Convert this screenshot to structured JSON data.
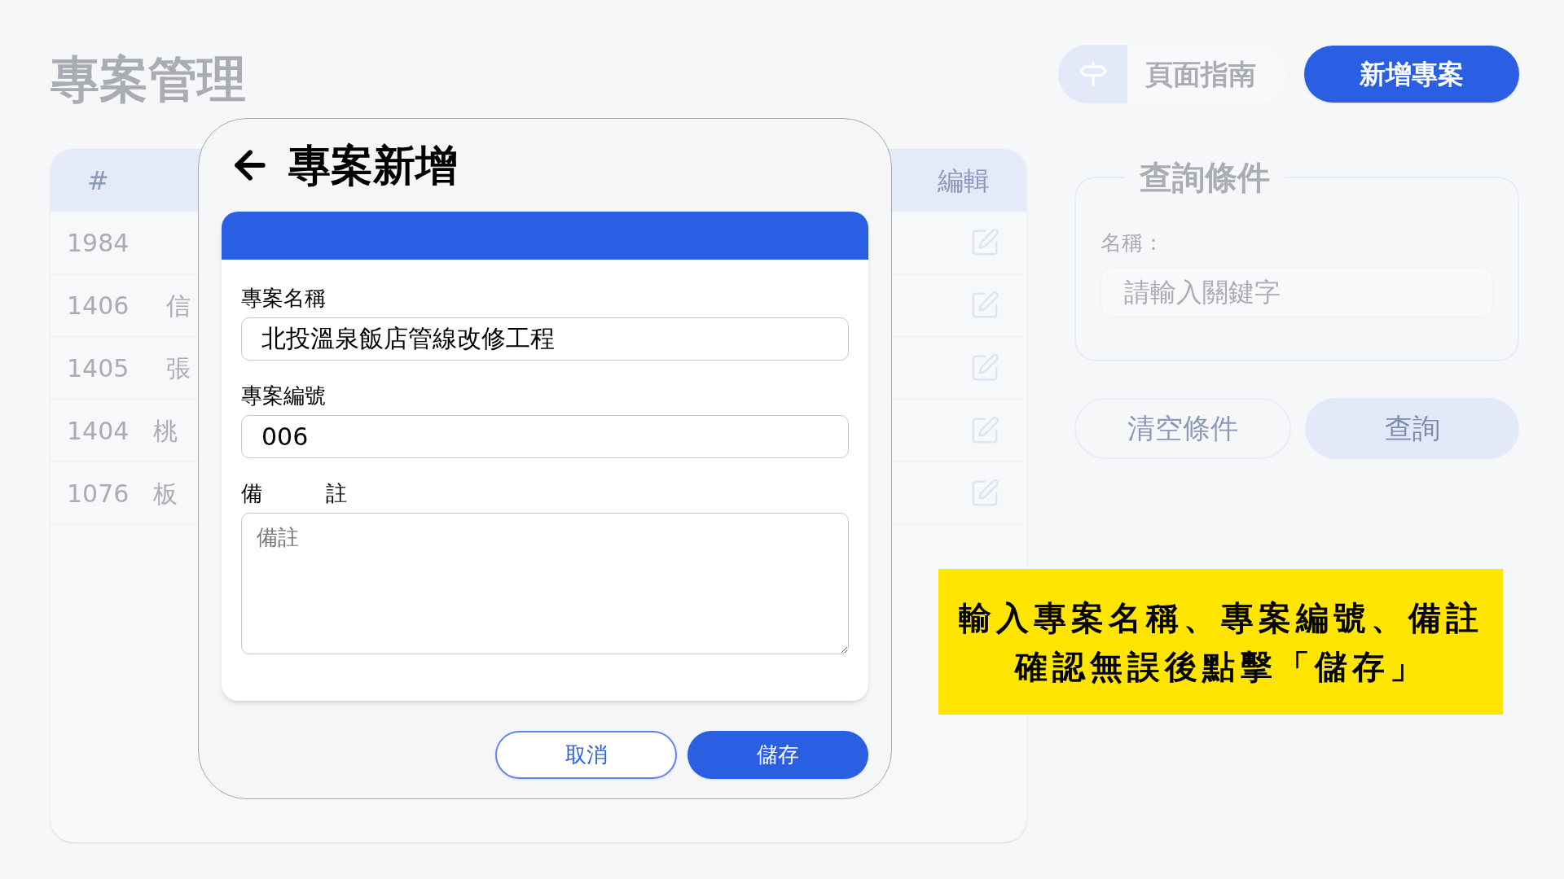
{
  "page": {
    "title": "專案管理"
  },
  "toolbar": {
    "guide_button": "頁面指南",
    "add_button": "新增專案"
  },
  "table": {
    "columns": [
      "#",
      "編輯"
    ],
    "rows": [
      {
        "id": "1984"
      },
      {
        "id": "1406",
        "name": "信"
      },
      {
        "id": "1405",
        "name": "張"
      },
      {
        "id": "1404",
        "name": "桃"
      },
      {
        "id": "1076",
        "name": "板"
      }
    ]
  },
  "query": {
    "legend": "查詢條件",
    "name_label": "名稱：",
    "name_placeholder": "請輸入關鍵字",
    "clear_button": "清空條件",
    "search_button": "查詢"
  },
  "dialog": {
    "title": "專案新增",
    "fields": [
      {
        "kind": "input",
        "label": "專案名稱",
        "value": "北投溫泉飯店管線改修工程"
      },
      {
        "kind": "input",
        "label": "專案編號",
        "value": "006"
      },
      {
        "kind": "textarea",
        "label": "備　　　註",
        "placeholder": "備註"
      }
    ],
    "buttons": [
      {
        "kind": "secondary",
        "label": "取消"
      },
      {
        "kind": "primary",
        "label": "儲存"
      }
    ]
  },
  "callout": {
    "lines": [
      "輸入專案名稱、專案編號、備註",
      "確認無誤後點擊「儲存」"
    ]
  }
}
